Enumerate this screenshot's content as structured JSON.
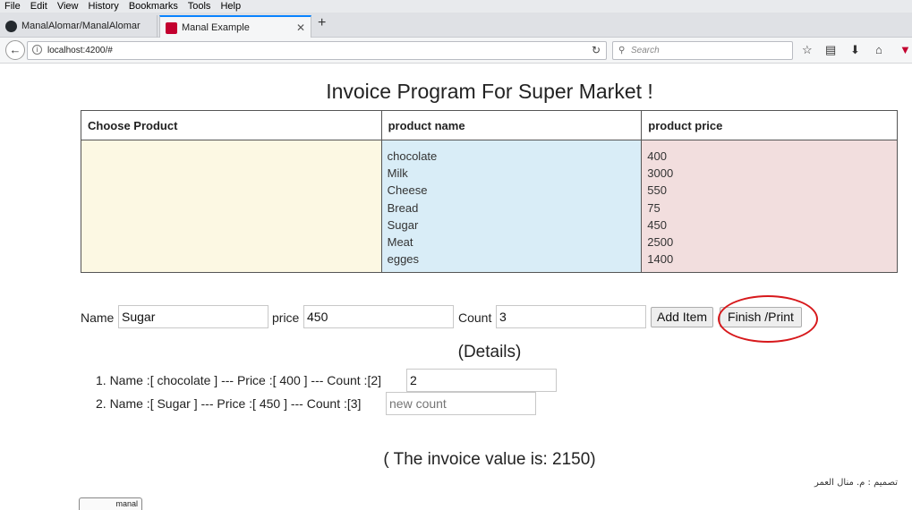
{
  "browser": {
    "menu": [
      "File",
      "Edit",
      "View",
      "History",
      "Bookmarks",
      "Tools",
      "Help"
    ],
    "tabs": [
      {
        "label": "ManalAlomar/ManalAlomar",
        "icon": "github-icon"
      },
      {
        "label": "Manal Example",
        "icon": "angular-icon"
      }
    ],
    "url": "localhost:4200/#",
    "search_placeholder": "Search"
  },
  "page": {
    "title": "Invoice Program For Super Market !",
    "table": {
      "headers": [
        "Choose Product",
        "product name",
        "product price"
      ],
      "products": [
        {
          "name": "chocolate",
          "price": "400"
        },
        {
          "name": "Milk",
          "price": "3000"
        },
        {
          "name": "Cheese",
          "price": "550"
        },
        {
          "name": "Bread",
          "price": "75"
        },
        {
          "name": "Sugar",
          "price": "450"
        },
        {
          "name": "Meat",
          "price": "2500"
        },
        {
          "name": "egges",
          "price": "1400"
        }
      ]
    },
    "form": {
      "name_label": "Name",
      "name_value": "Sugar",
      "price_label": "price",
      "price_value": "450",
      "count_label": "Count",
      "count_value": "3",
      "add_label": "Add Item",
      "finish_label": "Finish /Print"
    },
    "details_title": "(Details)",
    "details": [
      {
        "text": "1. Name :[ chocolate ] --- Price :[ 400 ] --- Count :[2]",
        "count_value": "2",
        "placeholder": ""
      },
      {
        "text": "2. Name :[ Sugar ] --- Price :[ 450 ] --- Count :[3]",
        "count_value": "",
        "placeholder": "new count"
      }
    ],
    "invoice_total": "( The invoice value is: 2150)",
    "credit": "تصميم : م. منال العمر",
    "badge": "manal"
  },
  "colors": {
    "choose_bg": "#fcf8e3",
    "name_bg": "#d9edf7",
    "price_bg": "#f2dede",
    "highlight": "#d7191c"
  }
}
